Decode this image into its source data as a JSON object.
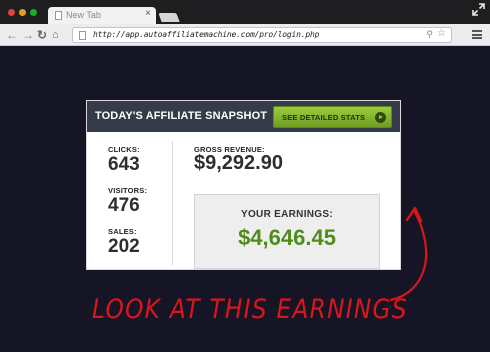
{
  "browser": {
    "tab_title": "New Tab",
    "url": "http://app.autoaffiliatemachine.com/pro/login.php",
    "close_glyph": "×"
  },
  "snapshot": {
    "title": "TODAY'S AFFILIATE SNAPSHOT",
    "stats_button_label": "SEE DETAILED STATS",
    "metrics": [
      {
        "label": "CLICKS:",
        "value": "643"
      },
      {
        "label": "VISITORS:",
        "value": "476"
      },
      {
        "label": "SALES:",
        "value": "202"
      }
    ],
    "gross_revenue_label": "GROSS REVENUE:",
    "gross_revenue_value": "$9,292.90",
    "earnings_label": "YOUR EARNINGS:",
    "earnings_value": "$4,646.45"
  },
  "annotation": {
    "text": "LOOK AT THIS EARNINGS",
    "color": "#d9161c"
  },
  "colors": {
    "page_background": "#161526",
    "card_header": "#353b48",
    "button_green": "#8cbf34",
    "earnings_green": "#4f8d1b"
  }
}
